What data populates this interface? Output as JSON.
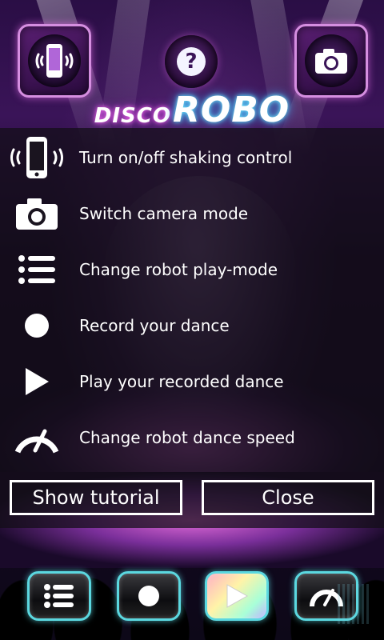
{
  "app": {
    "logo_small": "DISCO",
    "logo_big": "ROBO"
  },
  "top_bar": {
    "left_icon": "shake-phone-icon",
    "center_icon": "help-icon",
    "center_glyph": "?",
    "right_icon": "camera-icon"
  },
  "help_overlay": {
    "items": [
      {
        "icon": "shake-phone-icon",
        "label": "Turn on/off shaking control"
      },
      {
        "icon": "camera-icon",
        "label": "Switch camera mode"
      },
      {
        "icon": "list-icon",
        "label": "Change robot play-mode"
      },
      {
        "icon": "record-icon",
        "label": "Record your dance"
      },
      {
        "icon": "play-icon",
        "label": "Play your recorded dance"
      },
      {
        "icon": "speed-gauge-icon",
        "label": "Change robot dance speed"
      }
    ],
    "show_tutorial_label": "Show tutorial",
    "close_label": "Close"
  },
  "bottom_bar": {
    "buttons": [
      {
        "icon": "list-icon"
      },
      {
        "icon": "record-icon"
      },
      {
        "icon": "play-icon",
        "active": true
      },
      {
        "icon": "speed-gauge-icon"
      }
    ]
  },
  "colors": {
    "overlay_bg": "#120e16",
    "top_button_border": "#d58ee0",
    "bottom_button_border": "#5bd8e0",
    "text": "#ffffff"
  }
}
